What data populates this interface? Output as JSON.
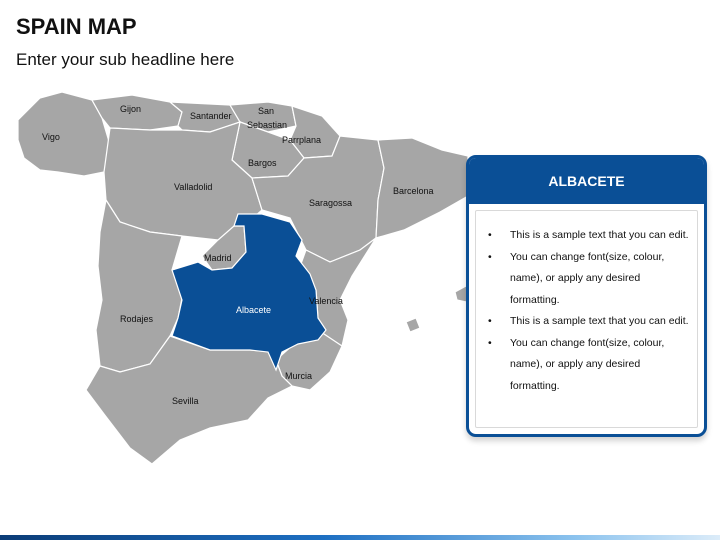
{
  "header": {
    "title": "SPAIN MAP",
    "subtitle": "Enter your sub headline here"
  },
  "map": {
    "labels": {
      "gijon": "Gijon",
      "santander": "Santander",
      "san_sebastian_line1": "San",
      "san_sebastian_line2": "Sebastian",
      "vigo": "Vigo",
      "parrplana": "Parrplana",
      "bargos": "Bargos",
      "valladolid": "Valladolid",
      "barcelona": "Barcelona",
      "saragossa": "Saragossa",
      "madrid": "Madrid",
      "albacete": "Albacete",
      "valencia": "Valencia",
      "rodajes": "Rodajes",
      "murcia": "Murcia",
      "sevilla": "Sevilla"
    },
    "colors": {
      "region": "#a6a6a6",
      "highlight": "#0a4f96",
      "border": "#ffffff"
    }
  },
  "card": {
    "title": "ALBACETE",
    "bullets": [
      "This is a sample text that you can edit.",
      "You can change font(size, colour, name), or apply any desired formatting.",
      "This is a sample text that you can edit.",
      "You can change font(size, colour, name), or apply any desired formatting."
    ],
    "accent_color": "#0a4f96"
  }
}
